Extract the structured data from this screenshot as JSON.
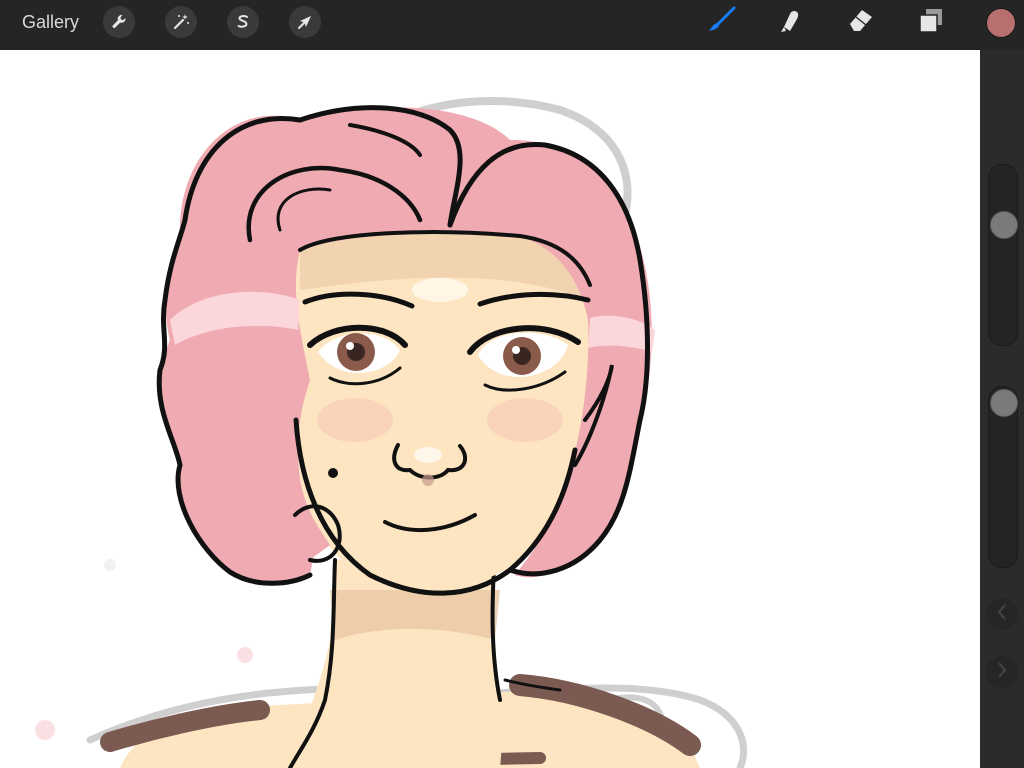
{
  "toolbar": {
    "gallery_label": "Gallery",
    "left_tools": [
      {
        "name": "actions",
        "icon": "wrench-icon"
      },
      {
        "name": "adjustments",
        "icon": "magic-wand-icon"
      },
      {
        "name": "selection",
        "icon": "selection-s-icon"
      },
      {
        "name": "transform",
        "icon": "arrow-cursor-icon"
      }
    ],
    "right_tools": [
      {
        "name": "brush",
        "icon": "brush-icon",
        "active": true
      },
      {
        "name": "smudge",
        "icon": "smudge-finger-icon",
        "active": false
      },
      {
        "name": "eraser",
        "icon": "eraser-icon",
        "active": false
      },
      {
        "name": "layers",
        "icon": "layers-icon",
        "active": false
      }
    ],
    "current_color": "#b86f6f",
    "active_tool_color": "#1a7cf5"
  },
  "sidebar": {
    "brush_size_slider": {
      "value": 0.7
    },
    "opacity_slider": {
      "value": 1.0
    },
    "undo_icon": "chevron-left-icon",
    "redo_icon": "chevron-right-icon"
  },
  "canvas": {
    "background": "#ffffff",
    "colors": {
      "hair": "#f0aab2",
      "hair_highlight": "#fbd6da",
      "skin": "#fde5c1",
      "skin_shadow": "#e9c7a4",
      "blush": "#f6cdb8",
      "eyes": "#8a5a4a",
      "clothing": "#7b5a52",
      "sketch": "#cfcfcf",
      "lineart": "#111111"
    }
  }
}
